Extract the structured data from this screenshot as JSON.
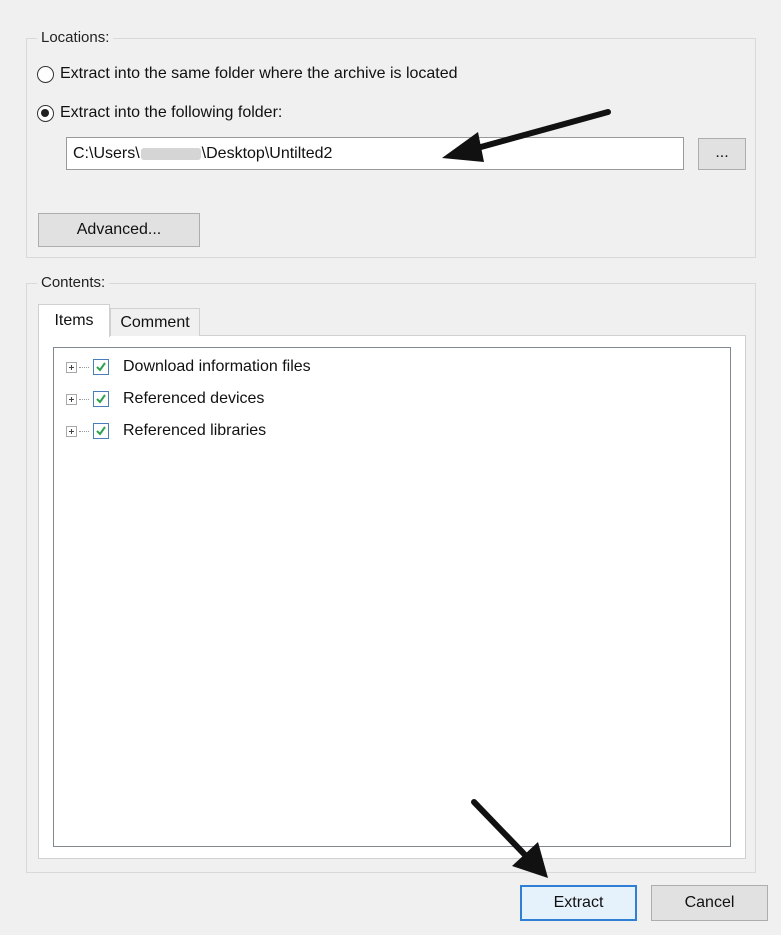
{
  "locations": {
    "legend": "Locations:",
    "option_same_folder": "Extract into the same folder where the archive is located",
    "option_following_folder": "Extract into the following folder:",
    "path_prefix": "C:\\Users\\",
    "path_suffix": "\\Desktop\\Untilted2",
    "browse_label": "...",
    "advanced_label": "Advanced..."
  },
  "contents": {
    "legend": "Contents:",
    "tabs": [
      {
        "label": "Items"
      },
      {
        "label": "Comment"
      }
    ],
    "items": [
      {
        "label": "Download information files",
        "checked": true
      },
      {
        "label": "Referenced devices",
        "checked": true
      },
      {
        "label": "Referenced libraries",
        "checked": true
      }
    ]
  },
  "footer": {
    "extract_label": "Extract",
    "cancel_label": "Cancel"
  },
  "colors": {
    "accent": "#2f7fd4",
    "checkmark": "#2aa34a"
  }
}
